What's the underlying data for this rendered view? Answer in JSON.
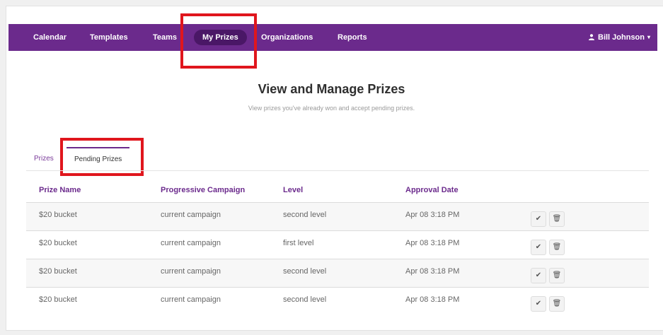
{
  "nav": {
    "items": [
      {
        "label": "Calendar"
      },
      {
        "label": "Templates"
      },
      {
        "label": "Teams"
      },
      {
        "label": "My Prizes"
      },
      {
        "label": "Organizations"
      },
      {
        "label": "Reports"
      }
    ],
    "active": "My Prizes",
    "user_name": "Bill Johnson",
    "user_icon": "user-icon",
    "colors": {
      "bar": "#6b2a8c",
      "active_pill": "#4a1766",
      "highlight": "#e0161d"
    }
  },
  "page": {
    "title": "View and Manage Prizes",
    "subtitle": "View prizes you've already won and accept pending prizes."
  },
  "tabs": [
    {
      "label": "Prizes"
    },
    {
      "label": "Pending Prizes"
    }
  ],
  "table": {
    "columns": [
      "Prize Name",
      "Progressive Campaign",
      "Level",
      "Approval Date"
    ],
    "rows": [
      {
        "prize": "$20 bucket",
        "campaign": "current campaign",
        "level": "second level",
        "date": "Apr 08 3:18 PM"
      },
      {
        "prize": "$20 bucket",
        "campaign": "current campaign",
        "level": "first level",
        "date": "Apr 08 3:18 PM"
      },
      {
        "prize": "$20 bucket",
        "campaign": "current campaign",
        "level": "second level",
        "date": "Apr 08 3:18 PM"
      },
      {
        "prize": "$20 bucket",
        "campaign": "current campaign",
        "level": "second level",
        "date": "Apr 08 3:18 PM"
      }
    ],
    "actions": {
      "accept_icon": "check-icon",
      "delete_icon": "trash-icon"
    }
  }
}
